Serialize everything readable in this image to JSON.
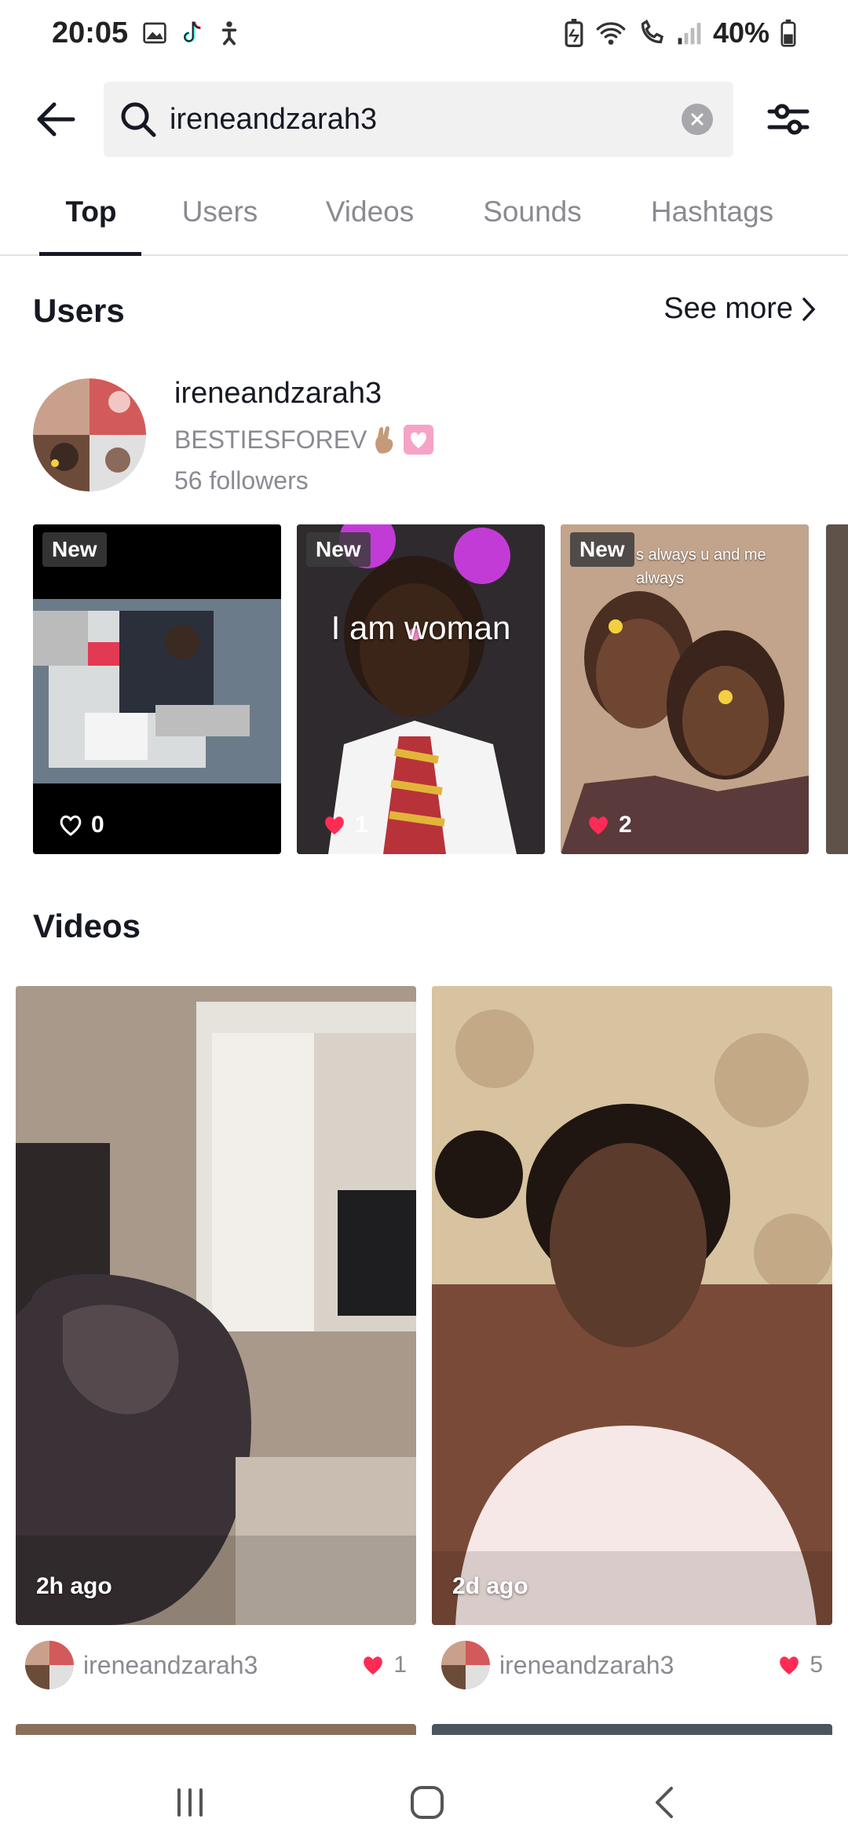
{
  "status_bar": {
    "time": "20:05",
    "battery_percent": "40%"
  },
  "search": {
    "value": "ireneandzarah3"
  },
  "tabs": [
    {
      "label": "Top",
      "active": true
    },
    {
      "label": "Users",
      "active": false
    },
    {
      "label": "Videos",
      "active": false
    },
    {
      "label": "Sounds",
      "active": false
    },
    {
      "label": "Hashtags",
      "active": false
    }
  ],
  "users_section": {
    "title": "Users",
    "see_more": "See more",
    "user": {
      "name": "ireneandzarah3",
      "bio": "BESTIESFOREV",
      "followers": "56 followers"
    },
    "thumbnails": [
      {
        "badge": "New",
        "likes": "0",
        "liked": false,
        "overlay": ""
      },
      {
        "badge": "New",
        "likes": "1",
        "liked": true,
        "overlay": "I am woman"
      },
      {
        "badge": "New",
        "likes": "2",
        "liked": true,
        "overlay": "s always u and me always"
      }
    ]
  },
  "videos_section": {
    "title": "Videos",
    "videos": [
      {
        "time": "2h ago",
        "user": "ireneandzarah3",
        "likes": "1"
      },
      {
        "time": "2d ago",
        "user": "ireneandzarah3",
        "likes": "5"
      }
    ]
  },
  "colors": {
    "like_red": "#fe2c55",
    "text_primary": "#161823",
    "text_secondary": "#8a8b91",
    "search_bg": "#f1f1f2"
  }
}
